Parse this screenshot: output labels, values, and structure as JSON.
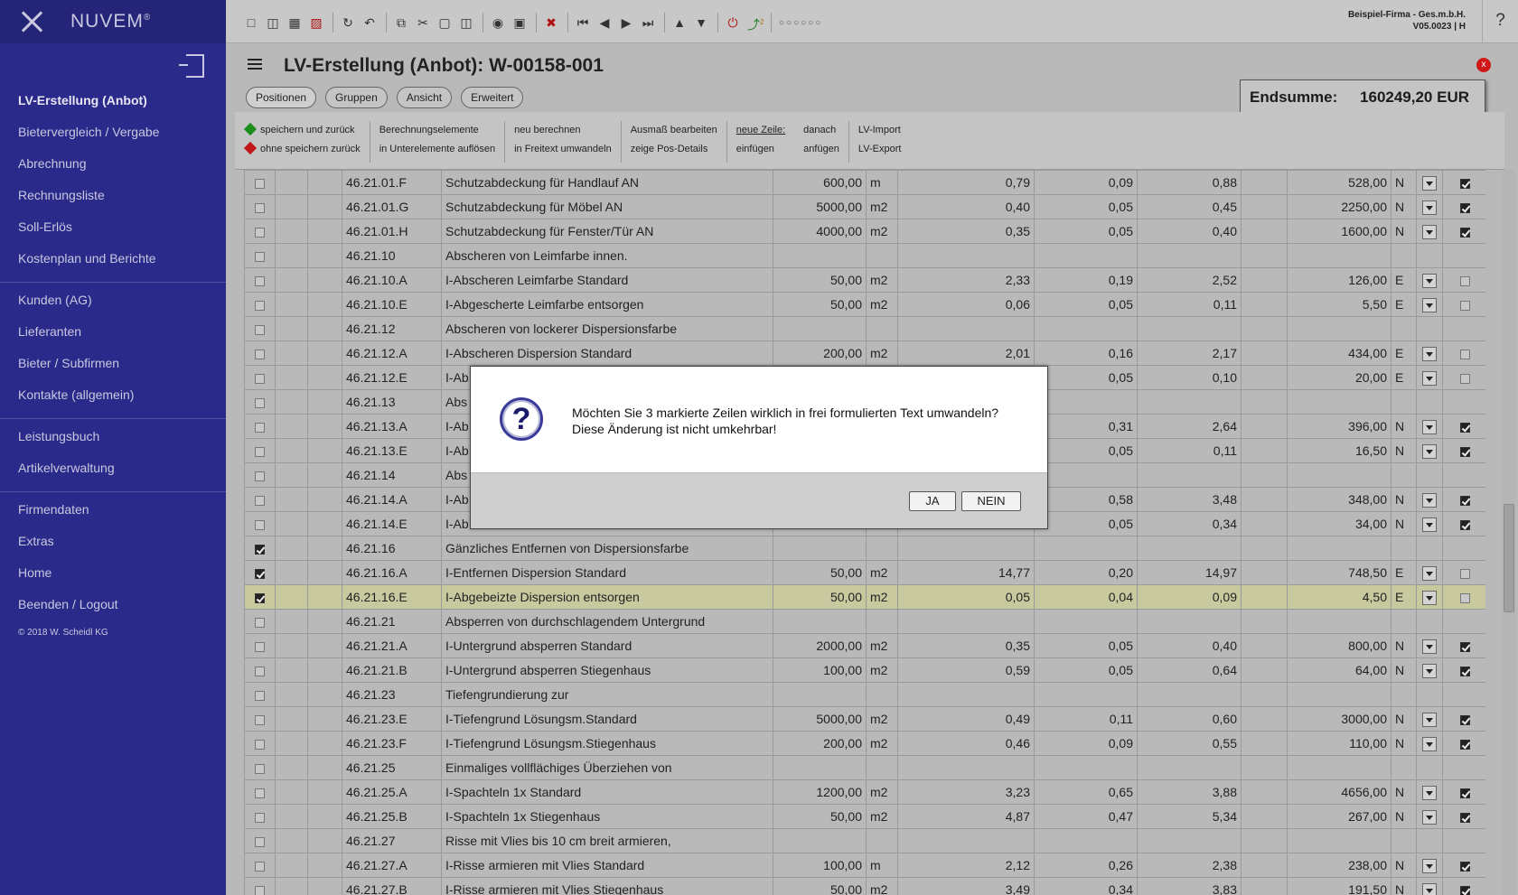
{
  "sidebar": {
    "logo": "NUVEM",
    "logo_mark": "®",
    "items": [
      {
        "label": "LV-Erstellung (Anbot)",
        "active": true
      },
      {
        "label": "Bietervergleich / Vergabe"
      },
      {
        "label": "Abrechnung"
      },
      {
        "label": "Rechnungsliste"
      },
      {
        "label": "Soll-Erlös"
      },
      {
        "label": "Kostenplan und Berichte"
      },
      {
        "label": "Kunden (AG)"
      },
      {
        "label": "Lieferanten"
      },
      {
        "label": "Bieter / Subfirmen"
      },
      {
        "label": "Kontakte (allgemein)"
      },
      {
        "label": "Leistungsbuch"
      },
      {
        "label": "Artikelverwaltung"
      },
      {
        "label": "Firmendaten"
      },
      {
        "label": "Extras"
      },
      {
        "label": "Home"
      },
      {
        "label": "Beenden / Logout"
      }
    ],
    "copyright": "© 2018 W. Scheidl KG"
  },
  "topbar": {
    "company": "Beispiel-Firma - Ges.m.b.H.",
    "version": "V05.0023 | H",
    "help": "?",
    "badge": "2",
    "dots": "○○○○○○"
  },
  "header": {
    "title": "LV-Erstellung (Anbot): W-00158-001",
    "close": "x",
    "endsumme_label": "Endsumme:",
    "endsumme_value": "160249,20 EUR"
  },
  "tabs": [
    "Positionen",
    "Gruppen",
    "Ansicht",
    "Erweitert"
  ],
  "actions": {
    "save_back": "speichern und zurück",
    "nosave_back": "ohne speichern zurück",
    "calc_elements": "Berechnungselemente",
    "resolve_sub": "in Unterelemente auflösen",
    "recalc": "neu berechnen",
    "to_freetext": "in Freitext umwandeln",
    "edit_measure": "Ausmaß bearbeiten",
    "show_pos": "zeige Pos-Details",
    "new_row": "neue Zeile:",
    "insert": "einfügen",
    "after": "danach",
    "append": "anfügen",
    "lv_import": "LV-Import",
    "lv_export": "LV-Export"
  },
  "rows": [
    {
      "chk": false,
      "pos": "46.21.01.F",
      "text": "Schutzabdeckung für Handlauf AN",
      "qty": "600,00",
      "unit": "m",
      "p1": "0,79",
      "p2": "0,09",
      "p3": "0,88",
      "total": "528,00",
      "type": "N",
      "flag": true
    },
    {
      "chk": false,
      "pos": "46.21.01.G",
      "text": "Schutzabdeckung für Möbel AN",
      "qty": "5000,00",
      "unit": "m2",
      "p1": "0,40",
      "p2": "0,05",
      "p3": "0,45",
      "total": "2250,00",
      "type": "N",
      "flag": true
    },
    {
      "chk": false,
      "pos": "46.21.01.H",
      "text": "Schutzabdeckung für Fenster/Tür AN",
      "qty": "4000,00",
      "unit": "m2",
      "p1": "0,35",
      "p2": "0,05",
      "p3": "0,40",
      "total": "1600,00",
      "type": "N",
      "flag": true
    },
    {
      "chk": false,
      "pos": "46.21.10",
      "text": "Abscheren von Leimfarbe innen.",
      "group": true
    },
    {
      "chk": false,
      "pos": "46.21.10.A",
      "text": "I-Abscheren Leimfarbe Standard",
      "qty": "50,00",
      "unit": "m2",
      "p1": "2,33",
      "p2": "0,19",
      "p3": "2,52",
      "total": "126,00",
      "type": "E",
      "flag": false
    },
    {
      "chk": false,
      "pos": "46.21.10.E",
      "text": "I-Abgescherte Leimfarbe entsorgen",
      "qty": "50,00",
      "unit": "m2",
      "p1": "0,06",
      "p2": "0,05",
      "p3": "0,11",
      "total": "5,50",
      "type": "E",
      "flag": false
    },
    {
      "chk": false,
      "pos": "46.21.12",
      "text": "Abscheren von lockerer Dispersionsfarbe",
      "group": true
    },
    {
      "chk": false,
      "pos": "46.21.12.A",
      "text": "I-Abscheren Dispersion Standard",
      "qty": "200,00",
      "unit": "m2",
      "p1": "2,01",
      "p2": "0,16",
      "p3": "2,17",
      "total": "434,00",
      "type": "E",
      "flag": false
    },
    {
      "chk": false,
      "pos": "46.21.12.E",
      "text": "I-Ab",
      "qty": "",
      "unit": "",
      "p1": "",
      "p2": "0,05",
      "p3": "0,10",
      "total": "20,00",
      "type": "E",
      "flag": false
    },
    {
      "chk": false,
      "pos": "46.21.13",
      "text": "Abs",
      "group": true
    },
    {
      "chk": false,
      "pos": "46.21.13.A",
      "text": "I-Ab",
      "qty": "",
      "unit": "",
      "p1": "",
      "p2": "0,31",
      "p3": "2,64",
      "total": "396,00",
      "type": "N",
      "flag": true
    },
    {
      "chk": false,
      "pos": "46.21.13.E",
      "text": "I-Ab",
      "qty": "",
      "unit": "",
      "p1": "",
      "p2": "0,05",
      "p3": "0,11",
      "total": "16,50",
      "type": "N",
      "flag": true
    },
    {
      "chk": false,
      "pos": "46.21.14",
      "text": "Abs",
      "group": true
    },
    {
      "chk": false,
      "pos": "46.21.14.A",
      "text": "I-Ab",
      "qty": "",
      "unit": "",
      "p1": "",
      "p2": "0,58",
      "p3": "3,48",
      "total": "348,00",
      "type": "N",
      "flag": true
    },
    {
      "chk": false,
      "pos": "46.21.14.E",
      "text": "I-Ab",
      "qty": "",
      "unit": "",
      "p1": "",
      "p2": "0,05",
      "p3": "0,34",
      "total": "34,00",
      "type": "N",
      "flag": true
    },
    {
      "chk": true,
      "pos": "46.21.16",
      "text": "Gänzliches Entfernen von Dispersionsfarbe",
      "group": true
    },
    {
      "chk": true,
      "pos": "46.21.16.A",
      "text": "I-Entfernen Dispersion Standard",
      "qty": "50,00",
      "unit": "m2",
      "p1": "14,77",
      "p2": "0,20",
      "p3": "14,97",
      "total": "748,50",
      "type": "E",
      "flag": false
    },
    {
      "chk": true,
      "pos": "46.21.16.E",
      "text": "I-Abgebeizte Dispersion entsorgen",
      "qty": "50,00",
      "unit": "m2",
      "p1": "0,05",
      "p2": "0,04",
      "p3": "0,09",
      "total": "4,50",
      "type": "E",
      "flag": false,
      "highlight": true
    },
    {
      "chk": false,
      "pos": "46.21.21",
      "text": "Absperren von durchschlagendem Untergrund",
      "group": true
    },
    {
      "chk": false,
      "pos": "46.21.21.A",
      "text": "I-Untergrund absperren Standard",
      "qty": "2000,00",
      "unit": "m2",
      "p1": "0,35",
      "p2": "0,05",
      "p3": "0,40",
      "total": "800,00",
      "type": "N",
      "flag": true
    },
    {
      "chk": false,
      "pos": "46.21.21.B",
      "text": "I-Untergrund absperren Stiegenhaus",
      "qty": "100,00",
      "unit": "m2",
      "p1": "0,59",
      "p2": "0,05",
      "p3": "0,64",
      "total": "64,00",
      "type": "N",
      "flag": true
    },
    {
      "chk": false,
      "pos": "46.21.23",
      "text": "Tiefengrundierung zur",
      "group": true
    },
    {
      "chk": false,
      "pos": "46.21.23.E",
      "text": "I-Tiefengrund Lösungsm.Standard",
      "qty": "5000,00",
      "unit": "m2",
      "p1": "0,49",
      "p2": "0,11",
      "p3": "0,60",
      "total": "3000,00",
      "type": "N",
      "flag": true
    },
    {
      "chk": false,
      "pos": "46.21.23.F",
      "text": "I-Tiefengrund Lösungsm.Stiegenhaus",
      "qty": "200,00",
      "unit": "m2",
      "p1": "0,46",
      "p2": "0,09",
      "p3": "0,55",
      "total": "110,00",
      "type": "N",
      "flag": true
    },
    {
      "chk": false,
      "pos": "46.21.25",
      "text": "Einmaliges vollflächiges Überziehen von",
      "group": true
    },
    {
      "chk": false,
      "pos": "46.21.25.A",
      "text": "I-Spachteln 1x Standard",
      "qty": "1200,00",
      "unit": "m2",
      "p1": "3,23",
      "p2": "0,65",
      "p3": "3,88",
      "total": "4656,00",
      "type": "N",
      "flag": true
    },
    {
      "chk": false,
      "pos": "46.21.25.B",
      "text": "I-Spachteln 1x Stiegenhaus",
      "qty": "50,00",
      "unit": "m2",
      "p1": "4,87",
      "p2": "0,47",
      "p3": "5,34",
      "total": "267,00",
      "type": "N",
      "flag": true
    },
    {
      "chk": false,
      "pos": "46.21.27",
      "text": "Risse mit Vlies bis 10 cm breit armieren,",
      "group": true
    },
    {
      "chk": false,
      "pos": "46.21.27.A",
      "text": "I-Risse armieren mit Vlies Standard",
      "qty": "100,00",
      "unit": "m",
      "p1": "2,12",
      "p2": "0,26",
      "p3": "2,38",
      "total": "238,00",
      "type": "N",
      "flag": true
    },
    {
      "chk": false,
      "pos": "46.21.27.B",
      "text": "I-Risse armieren mit Vlies Stiegenhaus",
      "qty": "50,00",
      "unit": "m2",
      "p1": "3,49",
      "p2": "0,34",
      "p3": "3,83",
      "total": "191,50",
      "type": "N",
      "flag": true
    }
  ],
  "modal": {
    "icon": "?",
    "line1": "Möchten Sie 3 markierte Zeilen wirklich in frei formulierten Text umwandeln?",
    "line2": "Diese Änderung ist nicht umkehrbar!",
    "yes": "JA",
    "no": "NEIN"
  }
}
